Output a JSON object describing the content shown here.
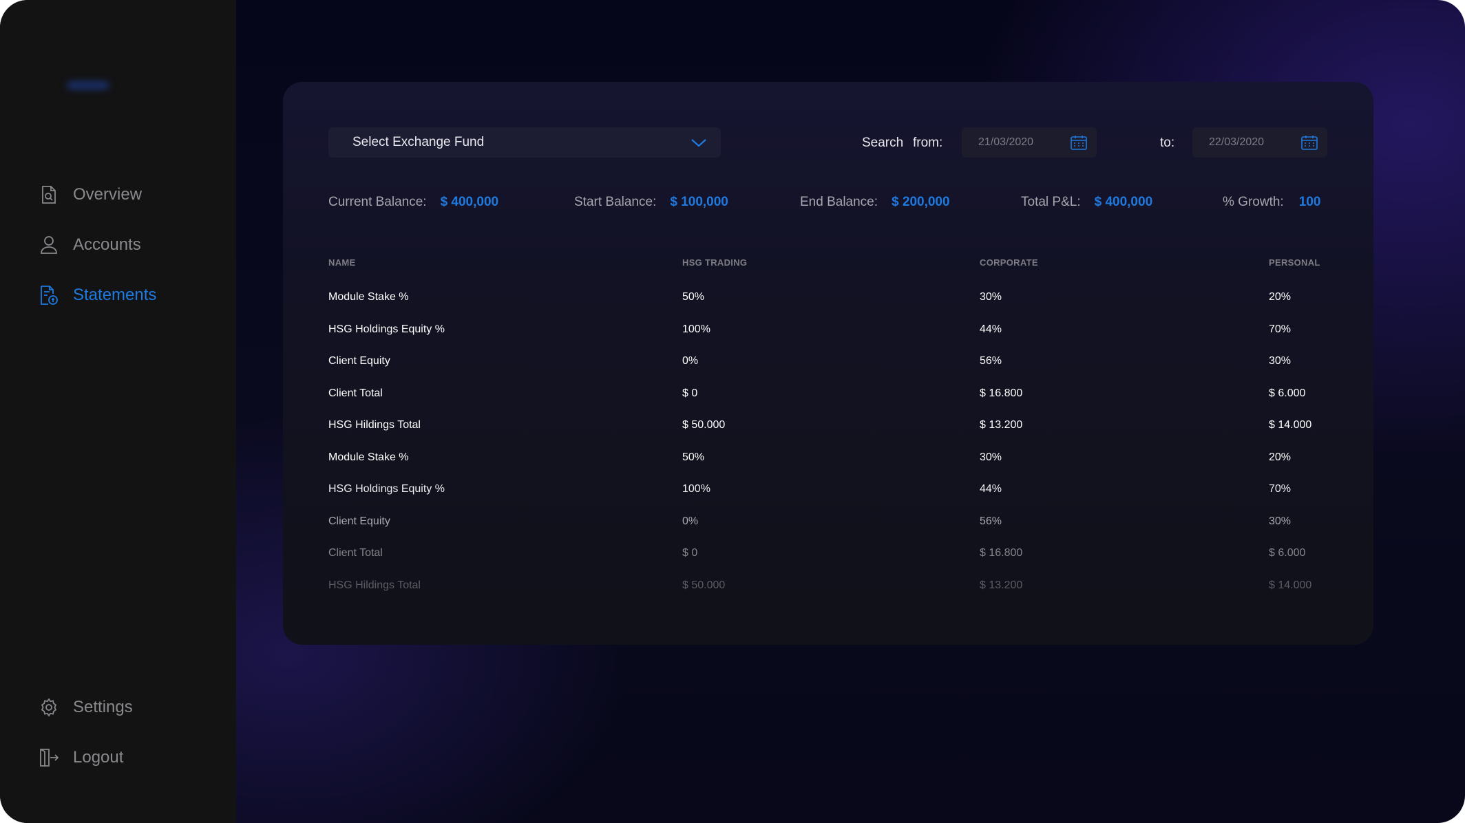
{
  "sidebar": {
    "nav_top": [
      {
        "label": "Overview",
        "icon": "document-search-icon",
        "active": false
      },
      {
        "label": "Accounts",
        "icon": "user-icon",
        "active": false
      },
      {
        "label": "Statements",
        "icon": "statement-icon",
        "active": true
      }
    ],
    "nav_bottom": [
      {
        "label": "Settings",
        "icon": "gear-icon"
      },
      {
        "label": "Logout",
        "icon": "logout-icon"
      }
    ]
  },
  "filters": {
    "fund_select": "Select Exchange Fund",
    "search_label": "Search",
    "from_label": "from:",
    "from_date": "21/03/2020",
    "to_label": "to:",
    "to_date": "22/03/2020"
  },
  "stats": [
    {
      "label": "Current Balance:",
      "value": "$ 400,000"
    },
    {
      "label": "Start Balance:",
      "value": "$ 100,000"
    },
    {
      "label": "End Balance:",
      "value": "$ 200,000"
    },
    {
      "label": "Total P&L:",
      "value": "$ 400,000"
    },
    {
      "label": "% Growth:",
      "value": "100"
    }
  ],
  "table": {
    "headers": [
      "NAME",
      "HSG TRADING",
      "CORPORATE",
      "PERSONAL"
    ],
    "rows": [
      [
        "Module Stake %",
        "50%",
        "30%",
        "20%"
      ],
      [
        "HSG Holdings Equity %",
        "100%",
        "44%",
        "70%"
      ],
      [
        "Client Equity",
        "0%",
        "56%",
        "30%"
      ],
      [
        "Client Total",
        "$ 0",
        "$ 16.800",
        "$ 6.000"
      ],
      [
        "HSG Hildings Total",
        "$ 50.000",
        "$ 13.200",
        "$ 14.000"
      ],
      [
        "Module Stake %",
        "50%",
        "30%",
        "20%"
      ],
      [
        "HSG Holdings Equity %",
        "100%",
        "44%",
        "70%"
      ],
      [
        "Client Equity",
        "0%",
        "56%",
        "30%"
      ],
      [
        "Client Total",
        "$ 0",
        "$ 16.800",
        "$ 6.000"
      ],
      [
        "HSG Hildings Total",
        "$ 50.000",
        "$ 13.200",
        "$ 14.000"
      ]
    ]
  },
  "colors": {
    "accent": "#1f7ae0",
    "sidebar_bg": "#131313",
    "text_primary": "#e8e8ee",
    "text_muted": "#8a8a8e"
  }
}
